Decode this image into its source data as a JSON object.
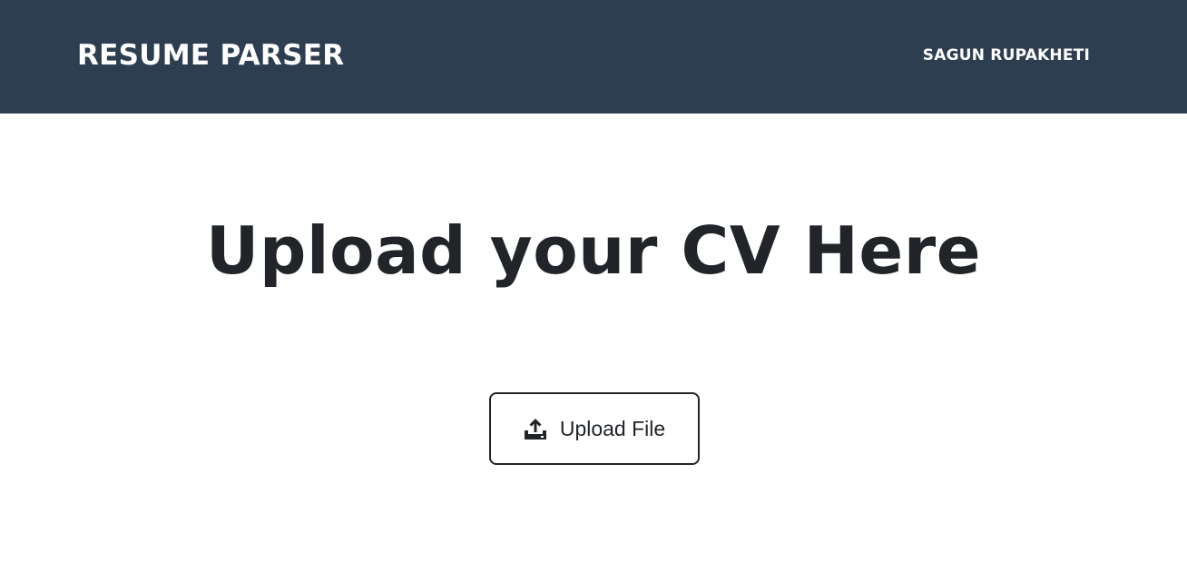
{
  "header": {
    "brand": "RESUME PARSER",
    "user_name": "SAGUN RUPAKHETI"
  },
  "main": {
    "title": "Upload your CV Here",
    "upload_button": {
      "label": "Upload File",
      "icon": "upload-icon"
    }
  },
  "colors": {
    "navbar_bg": "#2c3e50",
    "text_dark": "#212529",
    "text_light": "#ffffff",
    "page_bg": "#ffffff"
  }
}
